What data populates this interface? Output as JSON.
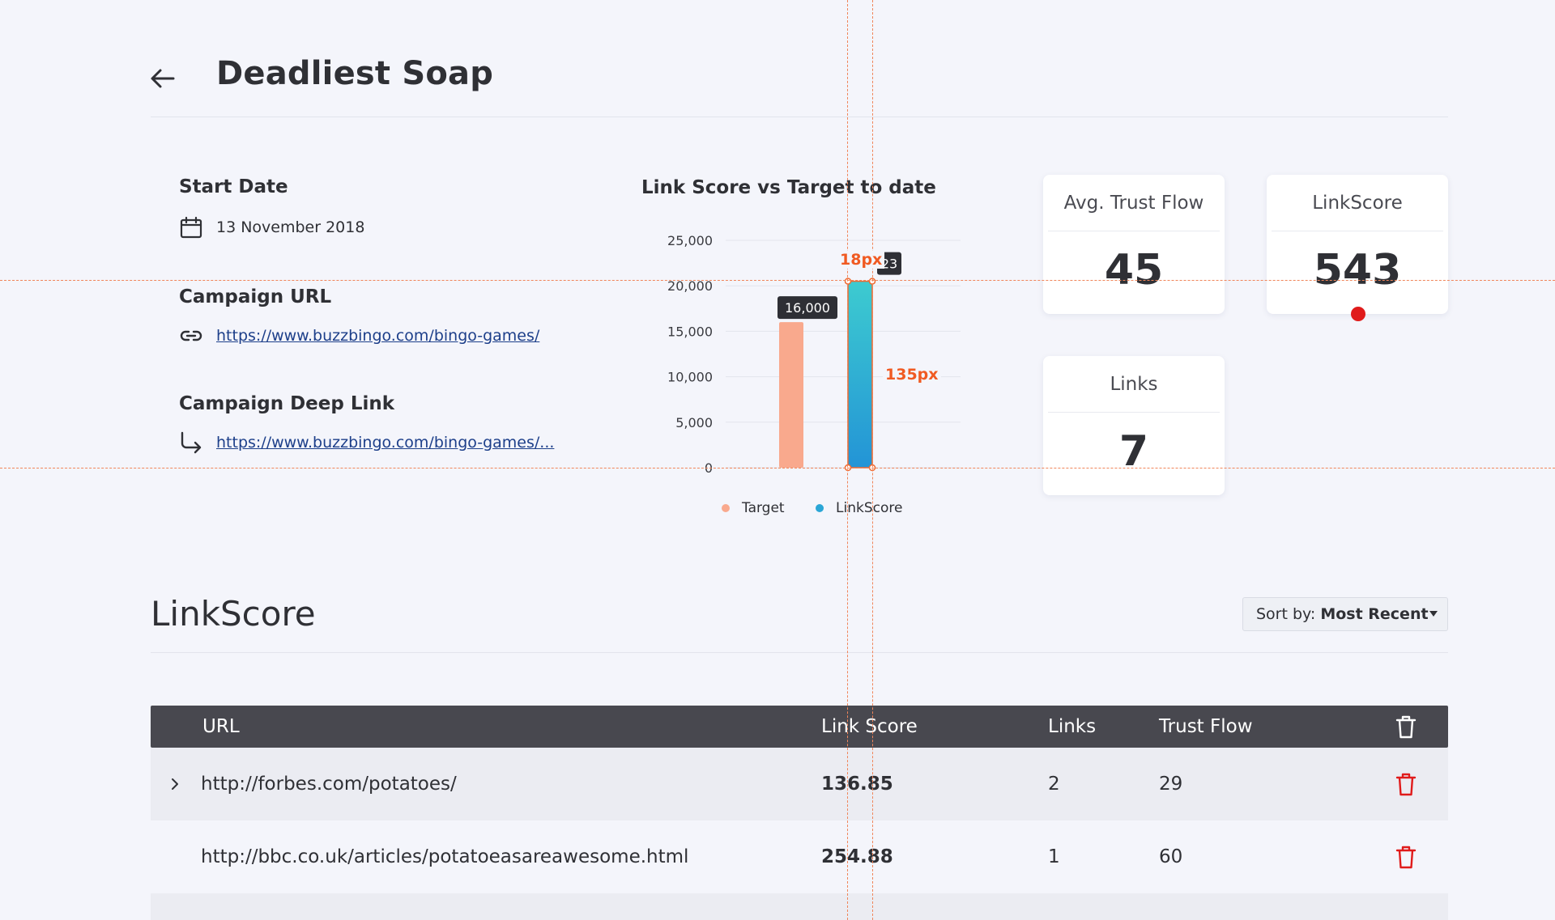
{
  "header": {
    "title": "Deadliest Soap"
  },
  "info": {
    "start_date_label": "Start Date",
    "start_date": "13 November 2018",
    "campaign_url_label": "Campaign URL",
    "campaign_url": "https://www.buzzbingo.com/bingo-games/",
    "deep_link_label": "Campaign Deep Link",
    "deep_link": "https://www.buzzbingo.com/bingo-games/..."
  },
  "chart_data": {
    "type": "bar",
    "title": "Link Score vs Target to date",
    "xlabel": "",
    "ylabel": "",
    "ylim": [
      0,
      25000
    ],
    "yticks": [
      "25,000",
      "20,000",
      "15,000",
      "10,000",
      "5,000",
      "0"
    ],
    "grid": true,
    "legend_position": "bottom",
    "series": [
      {
        "name": "Target",
        "value": 16000,
        "label": "16,000",
        "color": "#f9a98d"
      },
      {
        "name": "LinkScore",
        "value": 20500,
        "label": "23",
        "color": "#2aa6d6"
      }
    ]
  },
  "cards": {
    "trust_flow": {
      "label": "Avg. Trust Flow",
      "value": "45"
    },
    "linkscore": {
      "label": "LinkScore",
      "value": "543"
    },
    "links": {
      "label": "Links",
      "value": "7"
    }
  },
  "section": {
    "title": "LinkScore",
    "sort_prefix": "Sort by:",
    "sort_value": "Most Recent"
  },
  "table": {
    "headers": {
      "url": "URL",
      "link_score": "Link Score",
      "links": "Links",
      "trust_flow": "Trust Flow"
    },
    "rows": [
      {
        "url": "http://forbes.com/potatoes/",
        "link_score": "136.85",
        "links": "2",
        "trust_flow": "29"
      },
      {
        "url": "http://bbc.co.uk/articles/potatoeasareawesome.html",
        "link_score": "254.88",
        "links": "1",
        "trust_flow": "60"
      }
    ]
  },
  "overlay": {
    "width_label": "18px",
    "height_label": "135px"
  },
  "colors": {
    "accent_red": "#e01b1b",
    "guide": "#f0855a",
    "header_bg": "#48484f",
    "link": "#1d3f8a"
  },
  "icons": [
    "back-arrow-icon",
    "calendar-icon",
    "link-icon",
    "deep-link-arrow-icon",
    "chevron-right-icon",
    "trash-icon",
    "chevron-down-icon"
  ]
}
